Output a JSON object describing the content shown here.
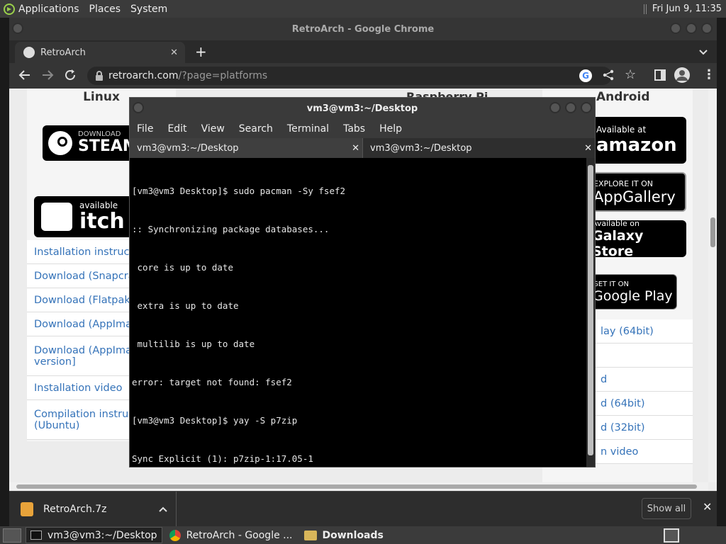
{
  "top_panel": {
    "menus": [
      "Applications",
      "Places",
      "System"
    ],
    "clock": "Fri Jun  9, 11:35"
  },
  "chrome": {
    "window_title": "RetroArch - Google Chrome",
    "tab_title": "RetroArch",
    "url_host": "retroarch.com",
    "url_path": "/?page=platforms"
  },
  "webpage": {
    "linux": {
      "heading": "Linux",
      "steam_top": "DOWNLOAD",
      "steam_main": "STEAM",
      "itch_top": "available",
      "itch_main": "itch",
      "links": [
        "Installation instructio",
        "Download (Snapcra",
        "Download (Flatpak)",
        "Download (AppIma",
        "Download (AppIma",
        "Installation video",
        "Compilation instruc"
      ],
      "link_seconds": [
        "version]",
        "(Ubuntu)"
      ]
    },
    "rpi_heading": "Raspberry Pi",
    "android": {
      "heading": "Android",
      "amazon_top": "Available at",
      "amazon_main": "amazon",
      "appgallery_top": "EXPLORE IT ON",
      "appgallery_main": "AppGallery",
      "galaxy_top": "Available on",
      "galaxy_main": "Galaxy Store",
      "gplay_top": "GET IT ON",
      "gplay_main": "Google Play",
      "links": [
        "lay (64bit)",
        "d",
        "d (64bit)",
        "d (32bit)",
        "n video"
      ]
    }
  },
  "terminal": {
    "title": "vm3@vm3:~/Desktop",
    "menu": [
      "File",
      "Edit",
      "View",
      "Search",
      "Terminal",
      "Tabs",
      "Help"
    ],
    "tabs": [
      "vm3@vm3:~/Desktop",
      "vm3@vm3:~/Desktop"
    ],
    "lines": [
      "[vm3@vm3 Desktop]$ sudo pacman -Sy fsef2",
      ":: Synchronizing package databases...",
      " core is up to date",
      " extra is up to date",
      " multilib is up to date",
      "error: target not found: fsef2",
      "[vm3@vm3 Desktop]$ yay -S p7zip",
      "Sync Explicit (1): p7zip-1:17.05-1"
    ]
  },
  "download_bar": {
    "file_name": "RetroArch.7z",
    "show_all": "Show all"
  },
  "taskbar": {
    "items": [
      "vm3@vm3:~/Desktop",
      "RetroArch - Google ...",
      "Downloads"
    ]
  }
}
